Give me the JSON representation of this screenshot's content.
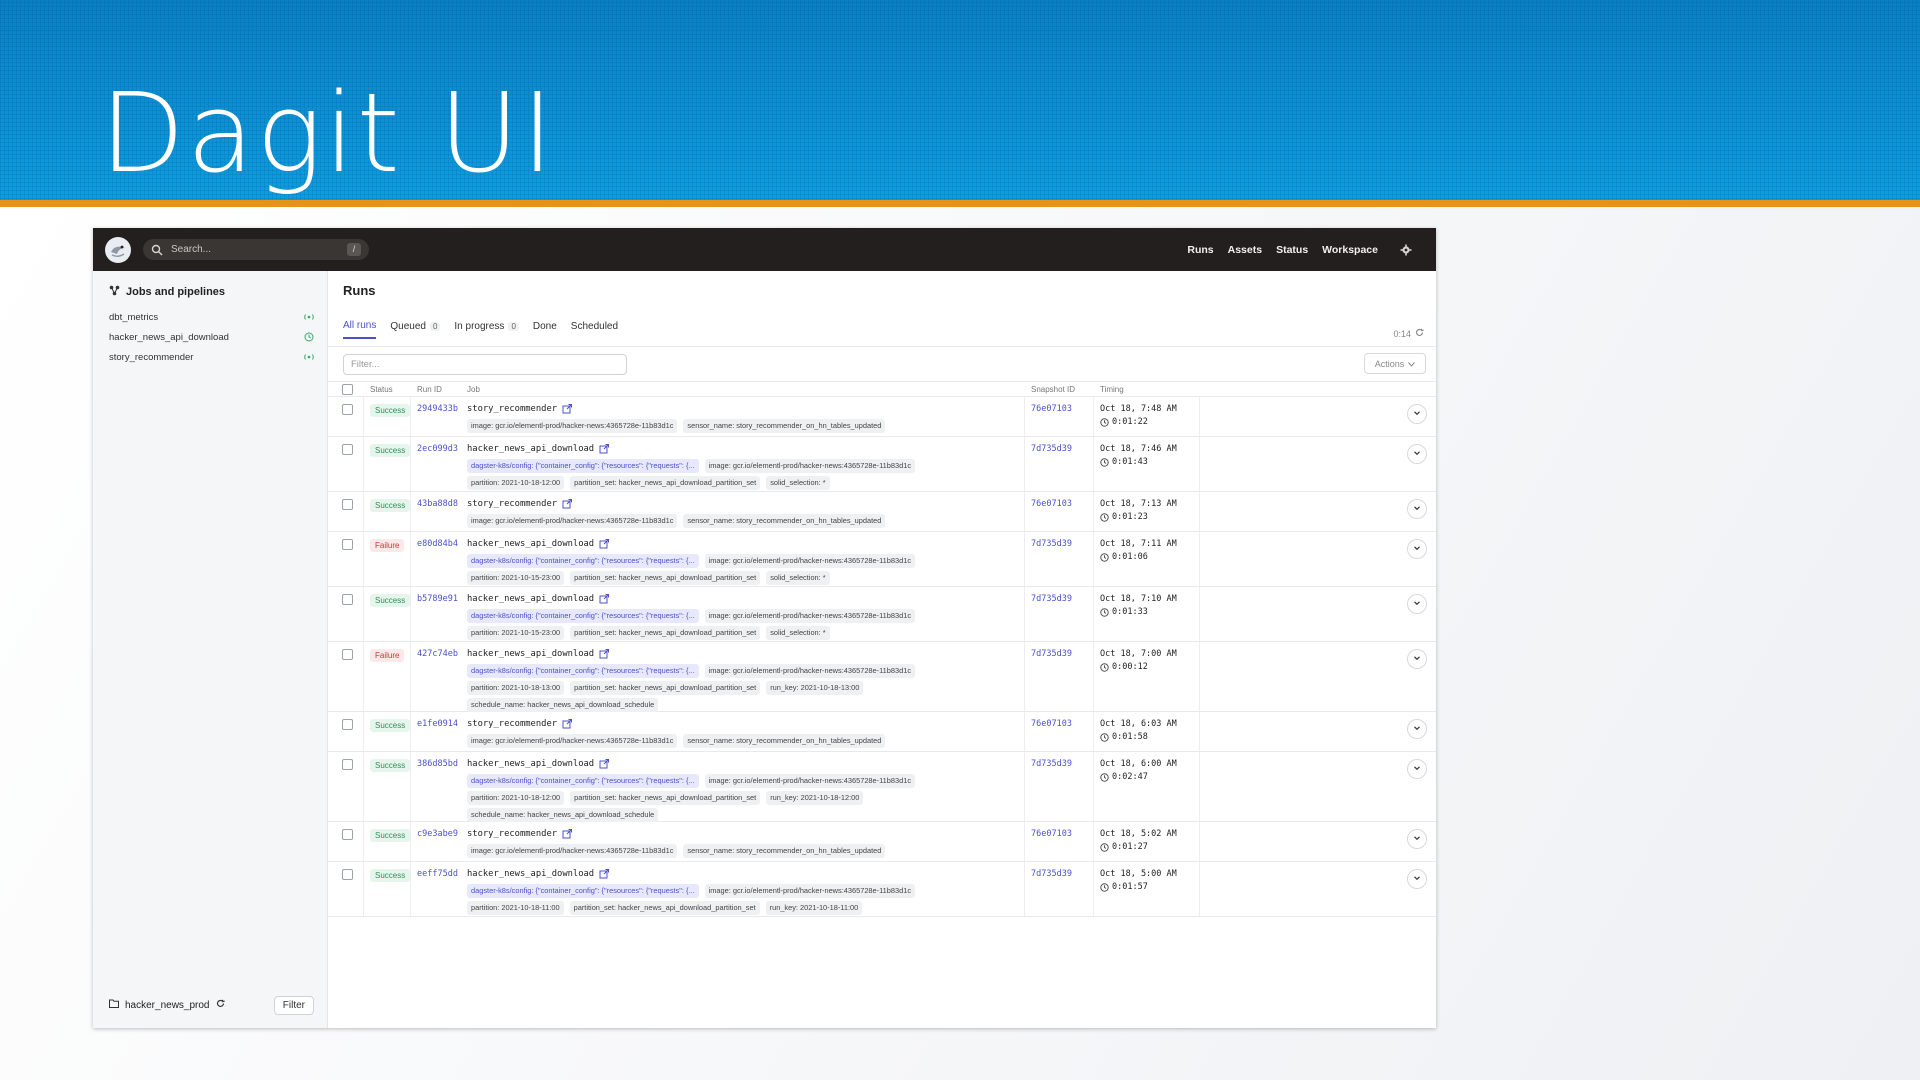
{
  "slide": {
    "title": "Dagit UI"
  },
  "topbar": {
    "search_placeholder": "Search...",
    "search_shortcut": "/",
    "nav": [
      "Runs",
      "Assets",
      "Status",
      "Workspace"
    ]
  },
  "sidebar": {
    "title": "Jobs and pipelines",
    "items": [
      {
        "label": "dbt_metrics",
        "status_icon": "sensor-icon"
      },
      {
        "label": "hacker_news_api_download",
        "status_icon": "schedule-icon"
      },
      {
        "label": "story_recommender",
        "status_icon": "sensor-icon"
      }
    ],
    "repo": "hacker_news_prod",
    "filter_button": "Filter"
  },
  "main": {
    "title": "Runs",
    "tabs": [
      {
        "label": "All runs",
        "count": ""
      },
      {
        "label": "Queued",
        "count": "0"
      },
      {
        "label": "In progress",
        "count": "0"
      },
      {
        "label": "Done",
        "count": ""
      },
      {
        "label": "Scheduled",
        "count": ""
      }
    ],
    "refresh_timer": "0:14",
    "filter_placeholder": "Filter...",
    "actions_label": "Actions",
    "columns": {
      "status": "Status",
      "run_id": "Run ID",
      "job": "Job",
      "snapshot": "Snapshot ID",
      "timing": "Timing"
    },
    "runs": [
      {
        "status": "Success",
        "run_id": "2949433b",
        "job": "story_recommender",
        "tag_lines": [
          [
            {
              "text": "image: gcr.io/elementl-prod/hacker-news:4365728e-11b83d1c",
              "purple": false
            },
            {
              "text": "sensor_name: story_recommender_on_hn_tables_updated",
              "purple": false
            }
          ]
        ],
        "snapshot": "76e07103",
        "time": "Oct 18, 7:48 AM",
        "duration": "0:01:22"
      },
      {
        "status": "Success",
        "run_id": "2ec099d3",
        "job": "hacker_news_api_download",
        "tag_lines": [
          [
            {
              "text": "dagster-k8s/config: {\"container_config\": {\"resources\": {\"requests\": {...",
              "purple": true
            },
            {
              "text": "image: gcr.io/elementl-prod/hacker-news:4365728e-11b83d1c",
              "purple": false
            }
          ],
          [
            {
              "text": "partition: 2021-10-18-12:00",
              "purple": false
            },
            {
              "text": "partition_set: hacker_news_api_download_partition_set",
              "purple": false
            },
            {
              "text": "solid_selection: *",
              "purple": false
            }
          ]
        ],
        "snapshot": "7d735d39",
        "time": "Oct 18, 7:46 AM",
        "duration": "0:01:43"
      },
      {
        "status": "Success",
        "run_id": "43ba88d8",
        "job": "story_recommender",
        "tag_lines": [
          [
            {
              "text": "image: gcr.io/elementl-prod/hacker-news:4365728e-11b83d1c",
              "purple": false
            },
            {
              "text": "sensor_name: story_recommender_on_hn_tables_updated",
              "purple": false
            }
          ]
        ],
        "snapshot": "76e07103",
        "time": "Oct 18, 7:13 AM",
        "duration": "0:01:23"
      },
      {
        "status": "Failure",
        "run_id": "e80d84b4",
        "job": "hacker_news_api_download",
        "tag_lines": [
          [
            {
              "text": "dagster-k8s/config: {\"container_config\": {\"resources\": {\"requests\": {...",
              "purple": true
            },
            {
              "text": "image: gcr.io/elementl-prod/hacker-news:4365728e-11b83d1c",
              "purple": false
            }
          ],
          [
            {
              "text": "partition: 2021-10-15-23:00",
              "purple": false
            },
            {
              "text": "partition_set: hacker_news_api_download_partition_set",
              "purple": false
            },
            {
              "text": "solid_selection: *",
              "purple": false
            }
          ]
        ],
        "snapshot": "7d735d39",
        "time": "Oct 18, 7:11 AM",
        "duration": "0:01:06"
      },
      {
        "status": "Success",
        "run_id": "b5789e91",
        "job": "hacker_news_api_download",
        "tag_lines": [
          [
            {
              "text": "dagster-k8s/config: {\"container_config\": {\"resources\": {\"requests\": {...",
              "purple": true
            },
            {
              "text": "image: gcr.io/elementl-prod/hacker-news:4365728e-11b83d1c",
              "purple": false
            }
          ],
          [
            {
              "text": "partition: 2021-10-15-23:00",
              "purple": false
            },
            {
              "text": "partition_set: hacker_news_api_download_partition_set",
              "purple": false
            },
            {
              "text": "solid_selection: *",
              "purple": false
            }
          ]
        ],
        "snapshot": "7d735d39",
        "time": "Oct 18, 7:10 AM",
        "duration": "0:01:33"
      },
      {
        "status": "Failure",
        "run_id": "427c74eb",
        "job": "hacker_news_api_download",
        "tag_lines": [
          [
            {
              "text": "dagster-k8s/config: {\"container_config\": {\"resources\": {\"requests\": {...",
              "purple": true
            },
            {
              "text": "image: gcr.io/elementl-prod/hacker-news:4365728e-11b83d1c",
              "purple": false
            }
          ],
          [
            {
              "text": "partition: 2021-10-18-13:00",
              "purple": false
            },
            {
              "text": "partition_set: hacker_news_api_download_partition_set",
              "purple": false
            },
            {
              "text": "run_key: 2021-10-18-13:00",
              "purple": false
            }
          ],
          [
            {
              "text": "schedule_name: hacker_news_api_download_schedule",
              "purple": false
            }
          ]
        ],
        "snapshot": "7d735d39",
        "time": "Oct 18, 7:00 AM",
        "duration": "0:00:12"
      },
      {
        "status": "Success",
        "run_id": "e1fe0914",
        "job": "story_recommender",
        "tag_lines": [
          [
            {
              "text": "image: gcr.io/elementl-prod/hacker-news:4365728e-11b83d1c",
              "purple": false
            },
            {
              "text": "sensor_name: story_recommender_on_hn_tables_updated",
              "purple": false
            }
          ]
        ],
        "snapshot": "76e07103",
        "time": "Oct 18, 6:03 AM",
        "duration": "0:01:58"
      },
      {
        "status": "Success",
        "run_id": "386d85bd",
        "job": "hacker_news_api_download",
        "tag_lines": [
          [
            {
              "text": "dagster-k8s/config: {\"container_config\": {\"resources\": {\"requests\": {...",
              "purple": true
            },
            {
              "text": "image: gcr.io/elementl-prod/hacker-news:4365728e-11b83d1c",
              "purple": false
            }
          ],
          [
            {
              "text": "partition: 2021-10-18-12:00",
              "purple": false
            },
            {
              "text": "partition_set: hacker_news_api_download_partition_set",
              "purple": false
            },
            {
              "text": "run_key: 2021-10-18-12:00",
              "purple": false
            }
          ],
          [
            {
              "text": "schedule_name: hacker_news_api_download_schedule",
              "purple": false
            }
          ]
        ],
        "snapshot": "7d735d39",
        "time": "Oct 18, 6:00 AM",
        "duration": "0:02:47"
      },
      {
        "status": "Success",
        "run_id": "c9e3abe9",
        "job": "story_recommender",
        "tag_lines": [
          [
            {
              "text": "image: gcr.io/elementl-prod/hacker-news:4365728e-11b83d1c",
              "purple": false
            },
            {
              "text": "sensor_name: story_recommender_on_hn_tables_updated",
              "purple": false
            }
          ]
        ],
        "snapshot": "76e07103",
        "time": "Oct 18, 5:02 AM",
        "duration": "0:01:27"
      },
      {
        "status": "Success",
        "run_id": "eeff75dd",
        "job": "hacker_news_api_download",
        "tag_lines": [
          [
            {
              "text": "dagster-k8s/config: {\"container_config\": {\"resources\": {\"requests\": {...",
              "purple": true
            },
            {
              "text": "image: gcr.io/elementl-prod/hacker-news:4365728e-11b83d1c",
              "purple": false
            }
          ],
          [
            {
              "text": "partition: 2021-10-18-11:00",
              "purple": false
            },
            {
              "text": "partition_set: hacker_news_api_download_partition_set",
              "purple": false
            },
            {
              "text": "run_key: 2021-10-18-11:00",
              "purple": false
            }
          ]
        ],
        "snapshot": "7d735d39",
        "time": "Oct 18, 5:00 AM",
        "duration": "0:01:57"
      }
    ]
  },
  "colors": {
    "header_blue": "#0b93d6",
    "accent_orange": "#e8911e",
    "link_purple": "#4b51c8",
    "success_green": "#2f8d58",
    "failure_red": "#c53a3a",
    "topbar_dark": "#231f1e"
  }
}
